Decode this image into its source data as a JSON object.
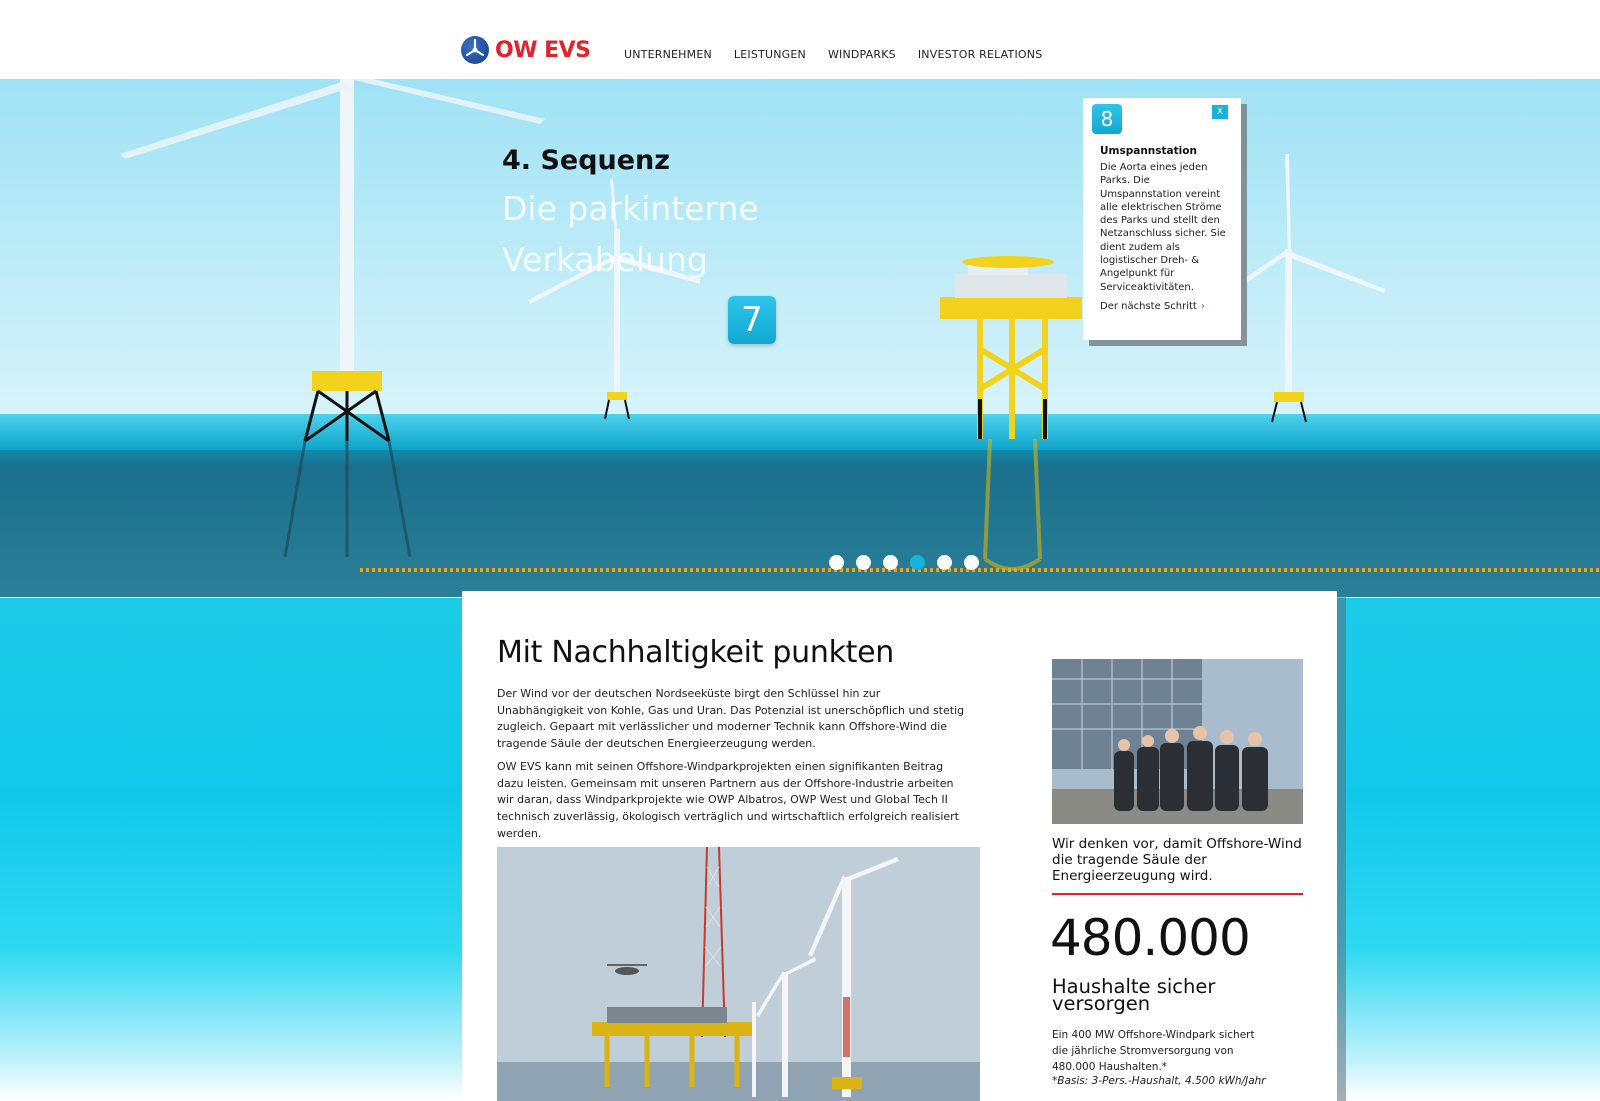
{
  "brand": {
    "name": "OW EVS",
    "logo_icon": "windmill-logo-icon",
    "accent": "#e3222c",
    "blue": "#16b3dc"
  },
  "nav": {
    "items": [
      {
        "label": "UNTERNEHMEN"
      },
      {
        "label": "LEISTUNGEN"
      },
      {
        "label": "WINDPARKS"
      },
      {
        "label": "INVESTOR RELATIONS"
      }
    ]
  },
  "hero": {
    "sequence_label": "4. Sequenz",
    "sequence_title": "Die parkinterne Verkabelung",
    "step_badge": "7",
    "popup": {
      "number": "8",
      "close_label": "X",
      "title": "Umspannstation",
      "text": "Die Aorta eines jeden Parks. Die Umspannstation vereint alle elektrischen Ströme des Parks und stellt den Netzanschluss sicher. Sie dient zudem als logistischer Dreh- & Angelpunkt für Serviceaktivitäten.",
      "next_label": "Der nächste Schritt",
      "next_icon": "chevron-right-icon"
    },
    "slides": {
      "count": 6,
      "active_index": 3
    }
  },
  "content": {
    "title": "Mit Nachhaltigkeit punkten",
    "paragraph1": "Der Wind vor der deutschen Nordseeküste birgt den Schlüssel hin zur Unabhängigkeit von Kohle, Gas und Uran. Das Potenzial ist unerschöpflich und stetig zugleich. Gepaart mit verlässlicher und moderner Technik kann Offshore-Wind die tragende Säule der deutschen Energieerzeugung werden.",
    "paragraph2": "OW EVS kann mit seinen Offshore-Windparkprojekten einen signifikanten Beitrag dazu leisten. Gemeinsam mit unseren Partnern aus der Offshore-Industrie arbeiten wir daran, dass Windparkprojekte wie OWP Albatros, OWP West und Global Tech II technisch zuverlässig, ökologisch verträglich und wirtschaftlich erfolgreich realisiert werden.",
    "quote": "Wir denken vor, damit Offshore-Wind die tragende Säule der Energieerzeugung wird.",
    "stat_number": "480.000",
    "stat_label": "Haushalte sicher versorgen",
    "stat_text": "Ein 400 MW Offshore-Windpark sichert die jährliche Stromversorgung von 480.000 Haushalten.*",
    "stat_note": "*Basis: 3-Pers.-Haushalt, 4.500 kWh/Jahr"
  }
}
